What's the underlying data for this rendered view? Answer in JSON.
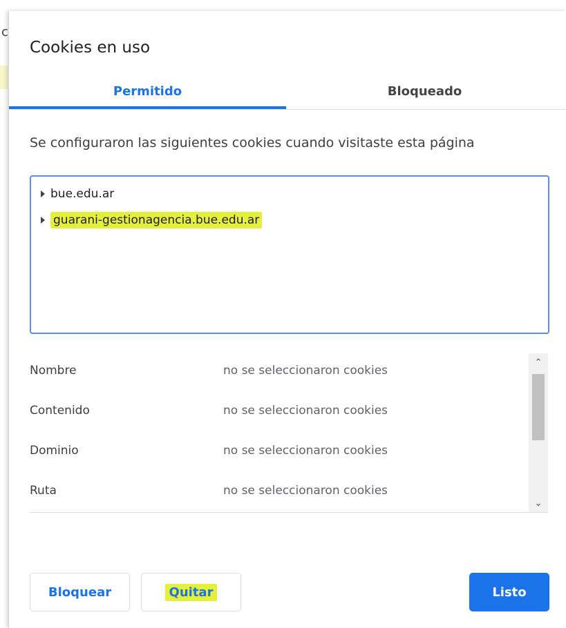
{
  "background": {
    "partial_char": "c"
  },
  "dialog": {
    "title": "Cookies en uso",
    "tabs": [
      {
        "label": "Permitido",
        "selected": true
      },
      {
        "label": "Bloqueado",
        "selected": false
      }
    ],
    "description": "Se configuraron las siguientes cookies cuando visitaste esta página",
    "cookie_tree": [
      {
        "label": "bue.edu.ar",
        "highlighted": false
      },
      {
        "label": "guarani-gestionagencia.bue.edu.ar",
        "highlighted": true
      }
    ],
    "details": [
      {
        "label": "Nombre",
        "value": "no se seleccionaron cookies"
      },
      {
        "label": "Contenido",
        "value": "no se seleccionaron cookies"
      },
      {
        "label": "Dominio",
        "value": "no se seleccionaron cookies"
      },
      {
        "label": "Ruta",
        "value": "no se seleccionaron cookies"
      }
    ],
    "buttons": {
      "block": "Bloquear",
      "remove": "Quitar",
      "done": "Listo"
    }
  },
  "colors": {
    "accent": "#1a73e8",
    "highlight": "#e5f03b"
  }
}
